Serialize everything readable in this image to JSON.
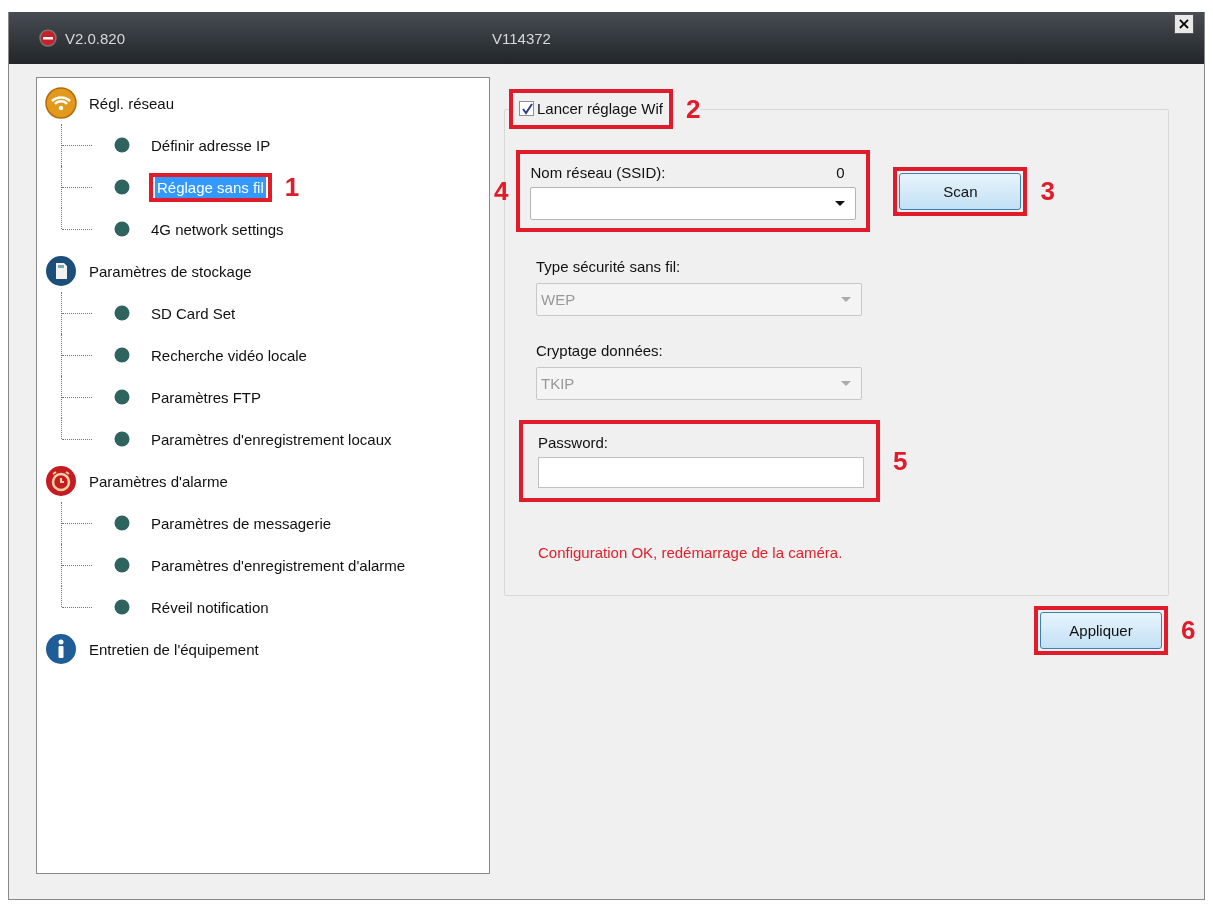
{
  "window": {
    "title": "V2.0.820",
    "subtitle": "V114372",
    "close": "×"
  },
  "tree": [
    {
      "label": "Régl. réseau",
      "kind": "wifi",
      "children": [
        {
          "label": "Définir adresse IP",
          "selected": false
        },
        {
          "label": "Réglage sans fil",
          "selected": true,
          "callout": "1"
        },
        {
          "label": "4G network settings",
          "selected": false
        }
      ]
    },
    {
      "label": "Paramètres de stockage",
      "kind": "storage",
      "children": [
        {
          "label": "SD Card Set",
          "selected": false
        },
        {
          "label": "Recherche vidéo locale",
          "selected": false
        },
        {
          "label": "Paramètres FTP",
          "selected": false
        },
        {
          "label": "Paramètres d'enregistrement locaux",
          "selected": false
        }
      ]
    },
    {
      "label": "Paramètres d'alarme",
      "kind": "alarm",
      "children": [
        {
          "label": "Paramètres de messagerie",
          "selected": false
        },
        {
          "label": "Paramètres d'enregistrement d'alarme",
          "selected": false
        },
        {
          "label": "Réveil notification",
          "selected": false
        }
      ]
    },
    {
      "label": "Entretien de l'équipement",
      "kind": "info"
    }
  ],
  "wifi_settings": {
    "enable": {
      "label": "Lancer réglage Wif",
      "checked": true,
      "callout": "2"
    },
    "ssid": {
      "label": "Nom réseau (SSID):",
      "count": "0",
      "callout": "4"
    },
    "scan_button": {
      "label": "Scan",
      "callout": "3"
    },
    "security": {
      "label": "Type sécurité sans fil:",
      "value": "WEP",
      "disabled": true
    },
    "encryption": {
      "label": "Cryptage données:",
      "value": "TKIP",
      "disabled": true
    },
    "password": {
      "label": "Password:",
      "callout": "5"
    },
    "message": "Configuration OK, redémarrage de la caméra."
  },
  "apply_button": {
    "label": "Appliquer",
    "callout": "6"
  }
}
